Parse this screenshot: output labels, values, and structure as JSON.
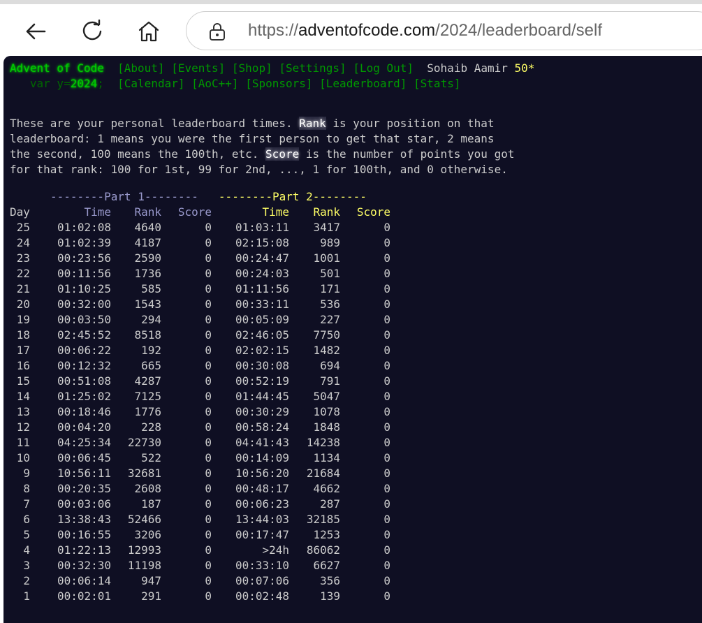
{
  "browser": {
    "url_scheme": "https://",
    "url_domain": "adventofcode.com",
    "url_path": "/2024/leaderboard/self"
  },
  "header": {
    "site_title": "Advent of Code",
    "year_prefix": "   var y=",
    "year": "2024",
    "year_suffix": ";",
    "nav_row1": [
      "[About]",
      "[Events]",
      "[Shop]",
      "[Settings]",
      "[Log Out]"
    ],
    "user_name": "Sohaib Aamir",
    "star_count": "50*",
    "nav_row2": [
      "[Calendar]",
      "[AoC++]",
      "[Sponsors]",
      "[Leaderboard]",
      "[Stats]"
    ]
  },
  "intro": {
    "line1_a": "These are your personal leaderboard times. ",
    "line1_b": "Rank",
    "line1_c": " is your position on that",
    "line2": "leaderboard: 1 means you were the first person to get that star, 2 means",
    "line3_a": "the second, 100 means the 100th, etc. ",
    "line3_b": "Score",
    "line3_c": " is the number of points you got",
    "line4": "for that rank: 100 for 1st, 99 for 2nd, ..., 1 for 100th, and 0 otherwise."
  },
  "table": {
    "part1_header": "--------Part 1--------",
    "part2_header": "--------Part 2--------",
    "col_day": "Day",
    "col_time": "Time",
    "col_rank": "Rank",
    "col_score": "Score",
    "rows": [
      {
        "day": "25",
        "t1": "01:02:08",
        "r1": "4640",
        "s1": "0",
        "t2": "01:03:11",
        "r2": "3417",
        "s2": "0"
      },
      {
        "day": "24",
        "t1": "01:02:39",
        "r1": "4187",
        "s1": "0",
        "t2": "02:15:08",
        "r2": "989",
        "s2": "0"
      },
      {
        "day": "23",
        "t1": "00:23:56",
        "r1": "2590",
        "s1": "0",
        "t2": "00:24:47",
        "r2": "1001",
        "s2": "0"
      },
      {
        "day": "22",
        "t1": "00:11:56",
        "r1": "1736",
        "s1": "0",
        "t2": "00:24:03",
        "r2": "501",
        "s2": "0"
      },
      {
        "day": "21",
        "t1": "01:10:25",
        "r1": "585",
        "s1": "0",
        "t2": "01:11:56",
        "r2": "171",
        "s2": "0"
      },
      {
        "day": "20",
        "t1": "00:32:00",
        "r1": "1543",
        "s1": "0",
        "t2": "00:33:11",
        "r2": "536",
        "s2": "0"
      },
      {
        "day": "19",
        "t1": "00:03:50",
        "r1": "294",
        "s1": "0",
        "t2": "00:05:09",
        "r2": "227",
        "s2": "0"
      },
      {
        "day": "18",
        "t1": "02:45:52",
        "r1": "8518",
        "s1": "0",
        "t2": "02:46:05",
        "r2": "7750",
        "s2": "0"
      },
      {
        "day": "17",
        "t1": "00:06:22",
        "r1": "192",
        "s1": "0",
        "t2": "02:02:15",
        "r2": "1482",
        "s2": "0"
      },
      {
        "day": "16",
        "t1": "00:12:32",
        "r1": "665",
        "s1": "0",
        "t2": "00:30:08",
        "r2": "694",
        "s2": "0"
      },
      {
        "day": "15",
        "t1": "00:51:08",
        "r1": "4287",
        "s1": "0",
        "t2": "00:52:19",
        "r2": "791",
        "s2": "0"
      },
      {
        "day": "14",
        "t1": "01:25:02",
        "r1": "7125",
        "s1": "0",
        "t2": "01:44:45",
        "r2": "5047",
        "s2": "0"
      },
      {
        "day": "13",
        "t1": "00:18:46",
        "r1": "1776",
        "s1": "0",
        "t2": "00:30:29",
        "r2": "1078",
        "s2": "0"
      },
      {
        "day": "12",
        "t1": "00:04:20",
        "r1": "228",
        "s1": "0",
        "t2": "00:58:24",
        "r2": "1848",
        "s2": "0"
      },
      {
        "day": "11",
        "t1": "04:25:34",
        "r1": "22730",
        "s1": "0",
        "t2": "04:41:43",
        "r2": "14238",
        "s2": "0"
      },
      {
        "day": "10",
        "t1": "00:06:45",
        "r1": "522",
        "s1": "0",
        "t2": "00:14:09",
        "r2": "1134",
        "s2": "0"
      },
      {
        "day": "9",
        "t1": "10:56:11",
        "r1": "32681",
        "s1": "0",
        "t2": "10:56:20",
        "r2": "21684",
        "s2": "0"
      },
      {
        "day": "8",
        "t1": "00:20:35",
        "r1": "2608",
        "s1": "0",
        "t2": "00:48:17",
        "r2": "4662",
        "s2": "0"
      },
      {
        "day": "7",
        "t1": "00:03:06",
        "r1": "187",
        "s1": "0",
        "t2": "00:06:23",
        "r2": "287",
        "s2": "0"
      },
      {
        "day": "6",
        "t1": "13:38:43",
        "r1": "52466",
        "s1": "0",
        "t2": "13:44:03",
        "r2": "32185",
        "s2": "0"
      },
      {
        "day": "5",
        "t1": "00:16:55",
        "r1": "3206",
        "s1": "0",
        "t2": "00:17:47",
        "r2": "1253",
        "s2": "0"
      },
      {
        "day": "4",
        "t1": "01:22:13",
        "r1": "12993",
        "s1": "0",
        "t2": ">24h",
        "r2": "86062",
        "s2": "0"
      },
      {
        "day": "3",
        "t1": "00:32:30",
        "r1": "11198",
        "s1": "0",
        "t2": "00:33:10",
        "r2": "6627",
        "s2": "0"
      },
      {
        "day": "2",
        "t1": "00:06:14",
        "r1": "947",
        "s1": "0",
        "t2": "00:07:06",
        "r2": "356",
        "s2": "0"
      },
      {
        "day": "1",
        "t1": "00:02:01",
        "r1": "291",
        "s1": "0",
        "t2": "00:02:48",
        "r2": "139",
        "s2": "0"
      }
    ]
  },
  "icons": {
    "back": "arrow-left-icon",
    "reload": "refresh-icon",
    "home": "home-icon",
    "lock": "lock-icon"
  },
  "colors": {
    "page_bg": "#0f0f23",
    "text": "#cccccc",
    "title_green": "#00cc00",
    "link_green": "#009900",
    "part1": "#9999cc",
    "part2": "#ffff66",
    "stars": "#ffff66"
  }
}
